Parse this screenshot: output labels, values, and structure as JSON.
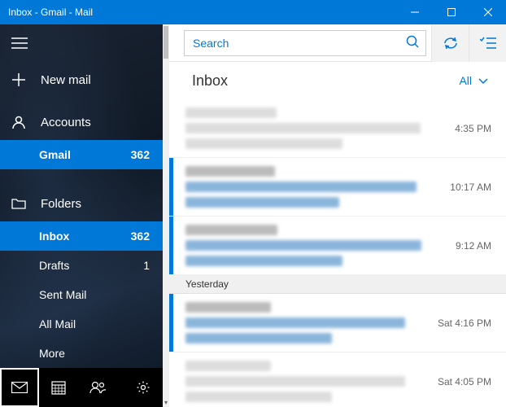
{
  "window": {
    "title": "Inbox - Gmail - Mail"
  },
  "sidebar": {
    "new_mail": "New mail",
    "accounts_label": "Accounts",
    "account": {
      "name": "Gmail",
      "count": "362"
    },
    "folders_label": "Folders",
    "folders": [
      {
        "name": "Inbox",
        "count": "362",
        "active": true
      },
      {
        "name": "Drafts",
        "count": "1",
        "active": false
      },
      {
        "name": "Sent Mail",
        "count": "",
        "active": false
      },
      {
        "name": "All Mail",
        "count": "",
        "active": false
      },
      {
        "name": "More",
        "count": "",
        "active": false
      }
    ]
  },
  "search": {
    "placeholder": "Search"
  },
  "list": {
    "title": "Inbox",
    "filter": "All",
    "groups": [
      {
        "separator": null,
        "messages": [
          {
            "time": "4:35 PM",
            "unread": false
          },
          {
            "time": "10:17 AM",
            "unread": true
          },
          {
            "time": "9:12 AM",
            "unread": true
          }
        ]
      },
      {
        "separator": "Yesterday",
        "messages": [
          {
            "time": "Sat 4:16 PM",
            "unread": true
          },
          {
            "time": "Sat 4:05 PM",
            "unread": false
          }
        ]
      }
    ]
  }
}
